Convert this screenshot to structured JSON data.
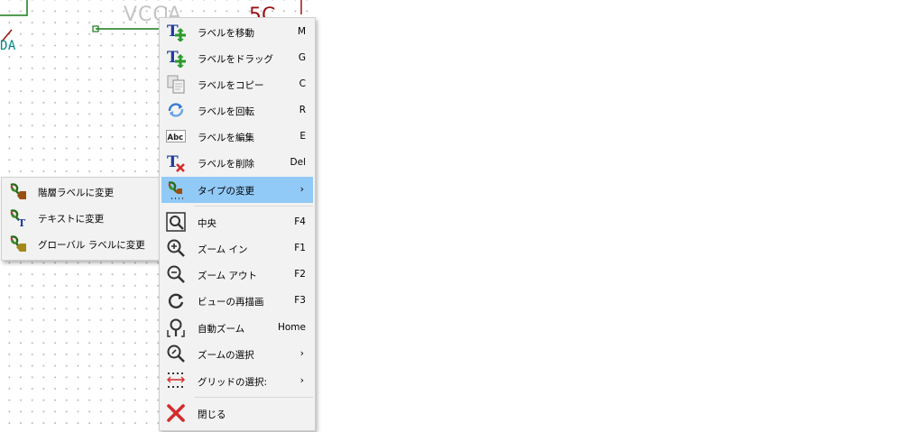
{
  "canvas": {
    "net_label": "DA",
    "power_label": "VCCA"
  },
  "context_menu": {
    "items": [
      {
        "label": "ラベルを移動",
        "shortcut": "M",
        "icon": "move-label-icon"
      },
      {
        "label": "ラベルをドラッグ",
        "shortcut": "G",
        "icon": "drag-label-icon"
      },
      {
        "label": "ラベルをコピー",
        "shortcut": "C",
        "icon": "copy-icon"
      },
      {
        "label": "ラベルを回転",
        "shortcut": "R",
        "icon": "rotate-icon"
      },
      {
        "label": "ラベルを編集",
        "shortcut": "E",
        "icon": "edit-text-icon",
        "icon_text": "Abc"
      },
      {
        "label": "ラベルを削除",
        "shortcut": "Del",
        "icon": "delete-label-icon"
      },
      {
        "label": "タイプの変更",
        "submenu_arrow": "›",
        "icon": "change-type-icon",
        "highlighted": true
      },
      {
        "label": "中央",
        "shortcut": "F4",
        "icon": "zoom-center-icon"
      },
      {
        "label": "ズーム イン",
        "shortcut": "F1",
        "icon": "zoom-in-icon"
      },
      {
        "label": "ズーム アウト",
        "shortcut": "F2",
        "icon": "zoom-out-icon"
      },
      {
        "label": "ビューの再描画",
        "shortcut": "F3",
        "icon": "redraw-icon"
      },
      {
        "label": "自動ズーム",
        "shortcut": "Home",
        "icon": "zoom-fit-icon"
      },
      {
        "label": "ズームの選択",
        "submenu_arrow": "›",
        "icon": "zoom-select-icon"
      },
      {
        "label": "グリッドの選択:",
        "submenu_arrow": "›",
        "icon": "grid-icon"
      },
      {
        "label": "閉じる",
        "icon": "close-icon"
      }
    ]
  },
  "submenu": {
    "items": [
      {
        "label": "階層ラベルに変更",
        "icon": "hierarchical-label-icon"
      },
      {
        "label": "テキストに変更",
        "icon": "text-icon",
        "icon_text": "T"
      },
      {
        "label": "グローバル ラベルに変更",
        "icon": "global-label-icon"
      }
    ]
  },
  "colors": {
    "highlight": "#91c9f7",
    "net_label": "#008a8a",
    "wire": "#1a7a1a",
    "power_symbol": "#c4c4c4",
    "component": "#9a1212"
  }
}
